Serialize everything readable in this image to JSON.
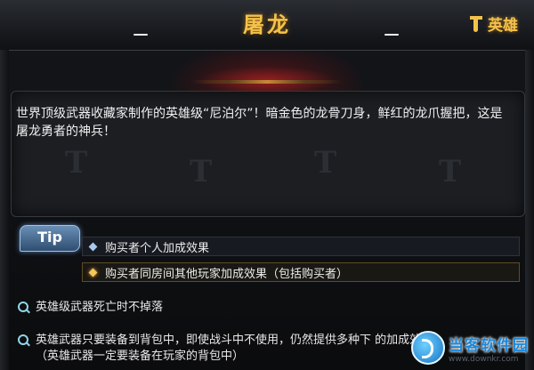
{
  "header": {
    "title": "屠龙",
    "hero_badge": "英雄"
  },
  "description": "世界顶级武器收藏家制作的英雄级“尼泊尔”！暗金色的龙骨刀身，鲜红的龙爪握把，这是屠龙勇者的神兵！",
  "tip": {
    "label": "Tip",
    "rows": [
      "购买者个人加成效果",
      "购买者同房间其他玩家加成效果（包括购买者）"
    ]
  },
  "features": [
    "英雄级武器死亡时不掉落",
    "英雄武器只要装备到背包中，即使战斗中不使用，仍然提供多种下    的加成效果",
    "（英雄武器一定要装备在玩家的背包中）"
  ],
  "watermark": {
    "name": "当客软件园",
    "url": "www.downkr.com"
  },
  "colors": {
    "title_gold": "#f4c24a",
    "tip_blue": "#4f76a3",
    "accent_cyan": "#8fd6e8"
  }
}
